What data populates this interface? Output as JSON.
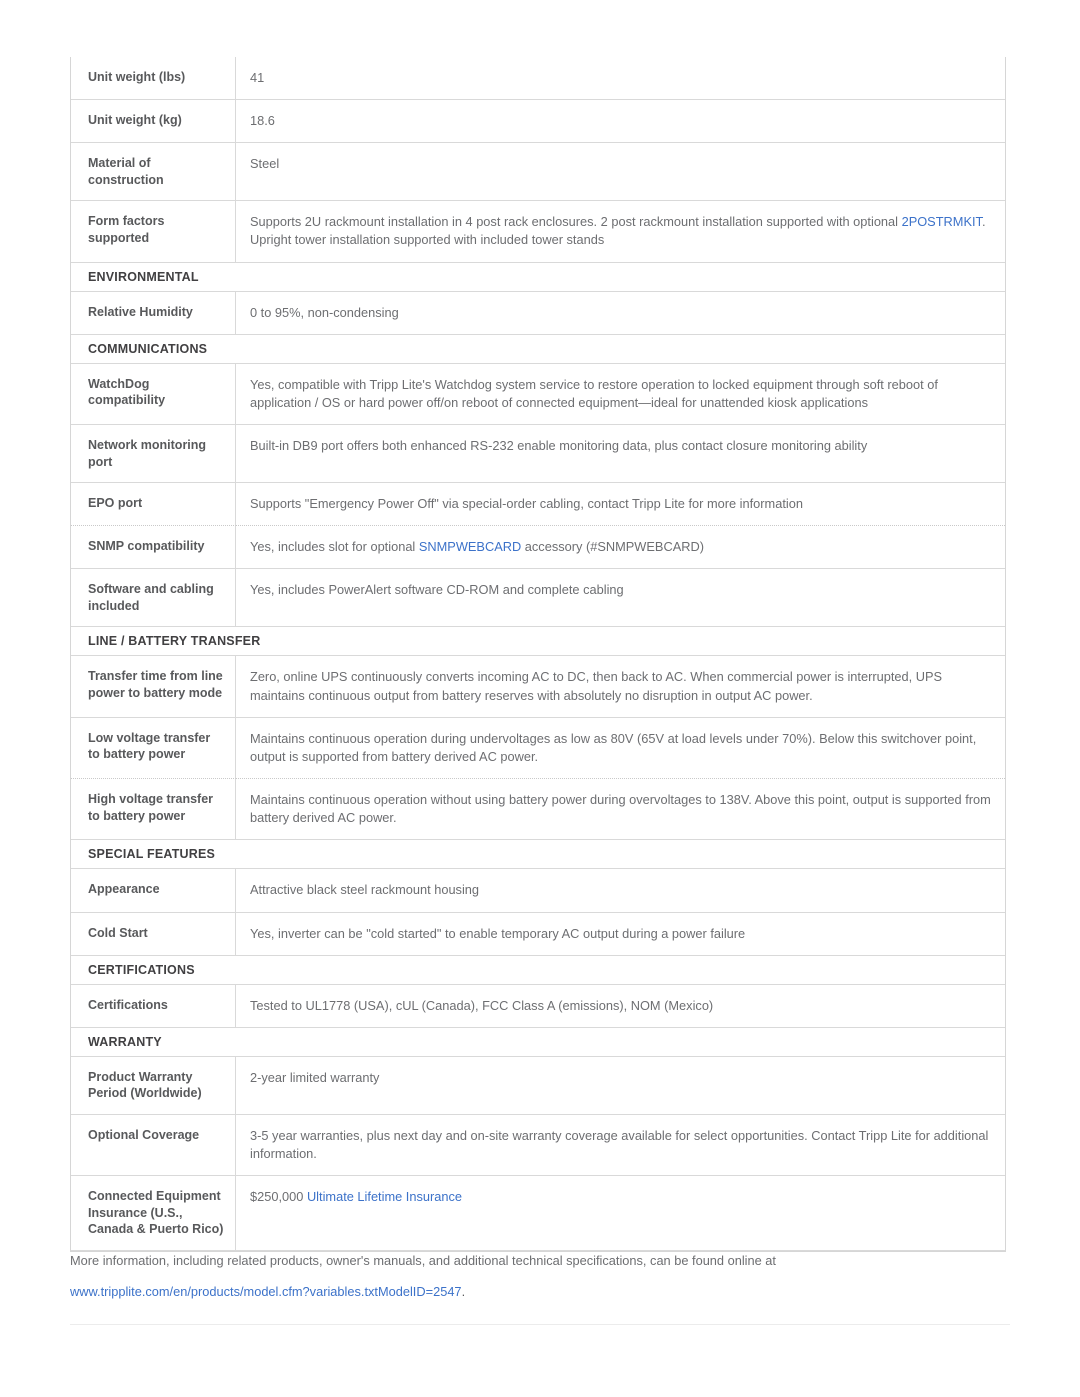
{
  "colors": {
    "link": "#3c72c9",
    "label_text": "#58595b",
    "value_text": "#6d6e71",
    "section_text": "#414042",
    "border": "#d9d9d9"
  },
  "spec_table": {
    "rows": [
      {
        "kind": "row",
        "label": "Unit weight (lbs)",
        "value": "41"
      },
      {
        "kind": "row",
        "label": "Unit weight (kg)",
        "value": "18.6"
      },
      {
        "kind": "row",
        "label": "Material of construction",
        "value": "Steel"
      },
      {
        "kind": "row",
        "label": "Form factors supported",
        "value_pre": "Supports 2U rackmount installation in 4 post rack enclosures. 2 post rackmount installation supported with optional ",
        "value_link": "2POSTRMKIT",
        "value_post": ". Upright tower installation supported with included tower stands"
      },
      {
        "kind": "section",
        "label": "ENVIRONMENTAL"
      },
      {
        "kind": "row",
        "label": "Relative Humidity",
        "value": "0 to 95%, non-condensing"
      },
      {
        "kind": "section",
        "label": "COMMUNICATIONS"
      },
      {
        "kind": "row",
        "label": "WatchDog compatibility",
        "value": "Yes, compatible with Tripp Lite's Watchdog system service to restore operation to locked equipment through soft reboot of application / OS or hard power off/on reboot of connected equipment—ideal for unattended kiosk applications"
      },
      {
        "kind": "row",
        "label": "Network monitoring port",
        "value": "Built-in DB9 port offers both enhanced RS-232 enable monitoring data, plus contact closure monitoring ability"
      },
      {
        "kind": "row",
        "label": "EPO port",
        "value": "Supports \"Emergency Power Off\" via special-order cabling, contact Tripp Lite for more information",
        "dotted": true
      },
      {
        "kind": "row",
        "label": "SNMP compatibility",
        "value_pre": "Yes, includes slot for optional ",
        "value_link": "SNMPWEBCARD",
        "value_post": " accessory (#SNMPWEBCARD)"
      },
      {
        "kind": "row",
        "label": "Software and cabling included",
        "value": "Yes, includes PowerAlert software CD-ROM and complete cabling"
      },
      {
        "kind": "section",
        "label": "LINE / BATTERY TRANSFER"
      },
      {
        "kind": "row",
        "label": "Transfer time from line power to battery mode",
        "value": "Zero, online UPS continuously converts incoming AC to DC, then back to AC. When commercial power is interrupted, UPS maintains continuous output from battery reserves with absolutely no disruption in output AC power."
      },
      {
        "kind": "row",
        "label": "Low voltage transfer to battery power",
        "value": "Maintains continuous operation during undervoltages as low as 80V (65V at load levels under 70%). Below this switchover point, output is supported from battery derived AC power.",
        "dotted": true
      },
      {
        "kind": "row",
        "label": "High voltage transfer to battery power",
        "value": "Maintains continuous operation without using battery power during overvoltages to 138V. Above this point, output is supported from battery derived AC power."
      },
      {
        "kind": "section",
        "label": "SPECIAL FEATURES"
      },
      {
        "kind": "row",
        "label": "Appearance",
        "value": "Attractive black steel rackmount housing"
      },
      {
        "kind": "row",
        "label": "Cold Start",
        "value": "Yes, inverter can be \"cold started\" to enable temporary AC output during a power failure"
      },
      {
        "kind": "section",
        "label": "CERTIFICATIONS"
      },
      {
        "kind": "row",
        "label": "Certifications",
        "value": "Tested to UL1778 (USA), cUL (Canada), FCC Class A (emissions), NOM (Mexico)"
      },
      {
        "kind": "section",
        "label": "WARRANTY"
      },
      {
        "kind": "row",
        "label": "Product Warranty Period (Worldwide)",
        "value": "2-year limited warranty"
      },
      {
        "kind": "row",
        "label": "Optional Coverage",
        "value": "3-5 year warranties, plus next day and on-site warranty coverage available for select opportunities. Contact Tripp Lite for additional information."
      },
      {
        "kind": "row",
        "label": "Connected Equipment Insurance (U.S., Canada & Puerto Rico)",
        "value_pre": "$250,000 ",
        "value_link": "Ultimate Lifetime Insurance",
        "value_post": ""
      }
    ]
  },
  "footer": {
    "line1": "More information, including related products, owner's manuals, and additional technical specifications, can be found online at",
    "link": "www.tripplite.com/en/products/model.cfm?variables.txtModelID=2547",
    "link_suffix": "."
  }
}
